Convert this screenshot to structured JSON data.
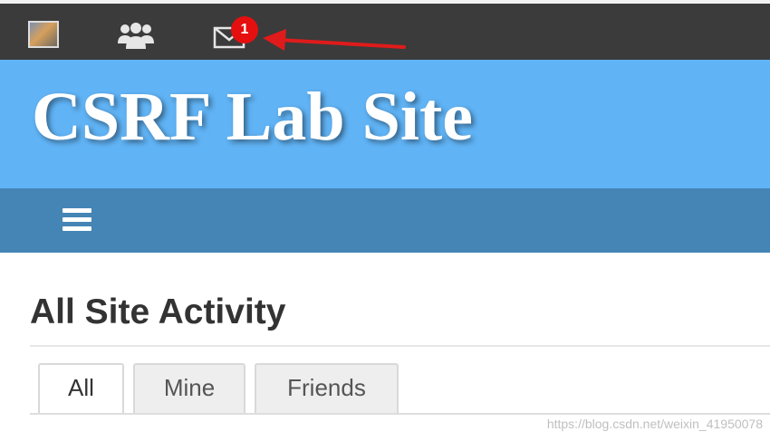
{
  "topbar": {
    "avatar_icon": "user-avatar",
    "friends_icon": "friends-icon",
    "messages_icon": "mail-icon",
    "messages_badge": "1"
  },
  "header": {
    "site_title": "CSRF Lab Site"
  },
  "navbar": {
    "menu_icon": "hamburger-menu-icon"
  },
  "main": {
    "page_title": "All Site Activity",
    "tabs": [
      {
        "label": "All",
        "active": true
      },
      {
        "label": "Mine",
        "active": false
      },
      {
        "label": "Friends",
        "active": false
      }
    ]
  },
  "watermark": "https://blog.csdn.net/weixin_41950078",
  "colors": {
    "topbar": "#3b3b3b",
    "header": "#60b3f5",
    "navbar": "#4485b6",
    "badge": "#e60f0f",
    "annotation_arrow": "#e01b1b"
  }
}
